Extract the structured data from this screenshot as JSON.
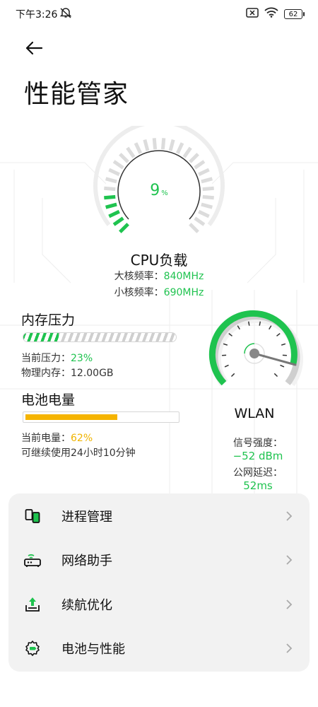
{
  "status_bar": {
    "time": "下午3:26",
    "battery_level": "62",
    "icons": [
      "mute-icon",
      "no-sim-icon",
      "wifi-icon",
      "battery-icon"
    ]
  },
  "header": {
    "back_icon": "back-arrow-icon",
    "title": "性能管家"
  },
  "cpu": {
    "load_percent": "9",
    "unit": "%",
    "title": "CPU负载",
    "big_core_label": "大核频率：",
    "big_core_value": "840MHz",
    "small_core_label": "小核频率：",
    "small_core_value": "690MHz"
  },
  "memory": {
    "title": "内存压力",
    "pressure_label": "当前压力：",
    "pressure_value": "23%",
    "pressure_fraction": 0.23,
    "physical_label": "物理内存：",
    "physical_value": "12.00GB"
  },
  "battery": {
    "title": "电池电量",
    "level_label": "当前电量：",
    "level_value": "62%",
    "level_fraction": 0.62,
    "remaining": "可继续使用24小时10分钟"
  },
  "wlan": {
    "title": "WLAN",
    "signal_label": "信号强度：",
    "signal_value": "−52 dBm",
    "latency_label": "公网延迟：",
    "latency_value": "52ms"
  },
  "menu": {
    "items": [
      {
        "label": "进程管理",
        "icon": "process-manager-icon"
      },
      {
        "label": "网络助手",
        "icon": "network-assistant-icon"
      },
      {
        "label": "续航优化",
        "icon": "battery-optimization-icon"
      },
      {
        "label": "电池与性能",
        "icon": "battery-performance-icon"
      }
    ],
    "chevron_icon": "chevron-right-icon"
  },
  "colors": {
    "accent_green": "#1fc34f",
    "accent_yellow": "#f5b400",
    "card_bg": "#f2f2f2"
  }
}
